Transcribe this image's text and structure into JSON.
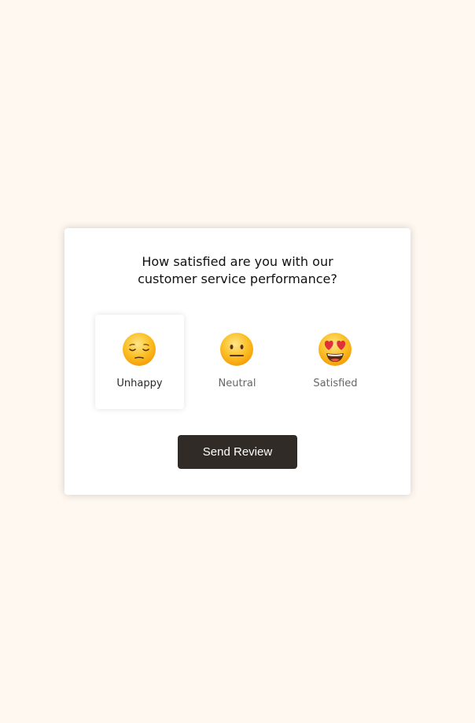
{
  "question": {
    "line1": "How satisfied are you with our",
    "line2": "customer service performance?"
  },
  "ratings": [
    {
      "label": "Unhappy",
      "icon": "relieved-face-icon",
      "selected": true
    },
    {
      "label": "Neutral",
      "icon": "neutral-face-icon",
      "selected": false
    },
    {
      "label": "Satisfied",
      "icon": "heart-eyes-face-icon",
      "selected": false
    }
  ],
  "submit": {
    "label": "Send Review"
  },
  "colors": {
    "page_bg": "#fef8f1",
    "card_bg": "#ffffff",
    "button_bg": "#302b27",
    "emoji_yellow": "#fbbf24",
    "heart_red": "#e0303a"
  }
}
